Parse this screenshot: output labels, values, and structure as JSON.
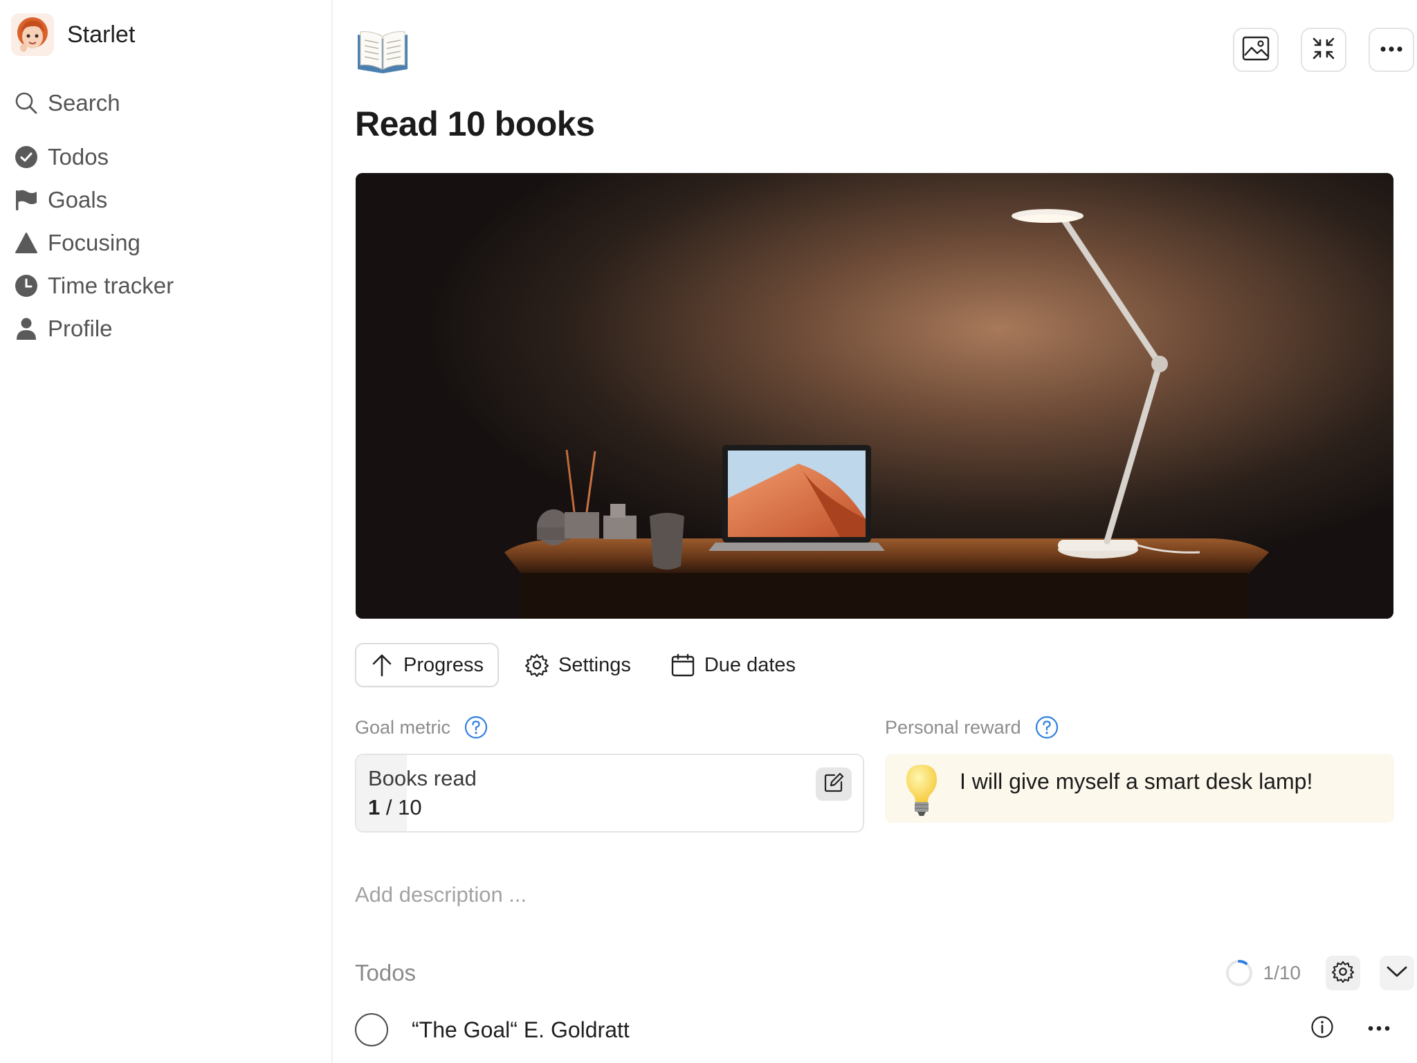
{
  "user": {
    "name": "Starlet",
    "avatar_icon": "redhead-woman-avatar"
  },
  "sidebar": {
    "search_label": "Search",
    "items": [
      {
        "label": "Todos",
        "icon": "check-circle-icon"
      },
      {
        "label": "Goals",
        "icon": "flag-icon"
      },
      {
        "label": "Focusing",
        "icon": "triangle-icon"
      },
      {
        "label": "Time tracker",
        "icon": "clock-icon"
      },
      {
        "label": "Profile",
        "icon": "person-icon"
      }
    ]
  },
  "page": {
    "emoji_icon": "open-book-icon",
    "title": "Read 10 books",
    "cover_description_icon": "desk-lamp-laptop-cover-image",
    "top_actions": [
      "image-icon",
      "collapse-icon",
      "more-icon"
    ]
  },
  "tabs": [
    {
      "label": "Progress",
      "icon": "arrow-up-icon",
      "active": true
    },
    {
      "label": "Settings",
      "icon": "gear-icon",
      "active": false
    },
    {
      "label": "Due dates",
      "icon": "calendar-icon",
      "active": false
    }
  ],
  "goal_metric": {
    "label": "Goal metric",
    "name": "Books read",
    "current": "1",
    "separator": " / ",
    "target": "10",
    "progress_fraction": 0.1
  },
  "reward": {
    "label": "Personal reward",
    "text": "I will give myself a smart desk lamp!",
    "icon": "light-bulb-icon"
  },
  "description": {
    "placeholder": "Add description ..."
  },
  "todos": {
    "title": "Todos",
    "count": "1/10",
    "progress_fraction": 0.1,
    "items": [
      {
        "text": "“The Goal“ E. Goldratt",
        "done": false
      }
    ]
  },
  "colors": {
    "accent_blue": "#2f7fe0",
    "reward_bg": "#fdf8ec",
    "sidebar_text": "#545454"
  }
}
